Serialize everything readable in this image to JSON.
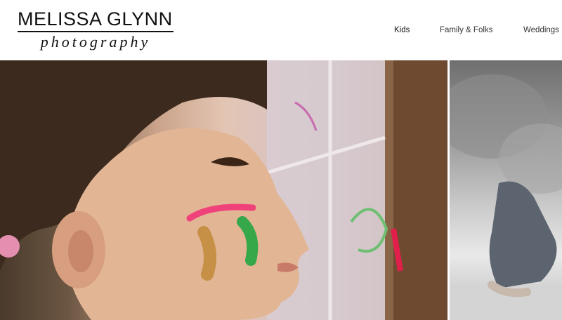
{
  "brand": {
    "name": "MELISSA GLYNN",
    "subtitle": "photography"
  },
  "nav": {
    "items": [
      {
        "label": "Kids",
        "active": true
      },
      {
        "label": "Family & Folks",
        "active": false
      },
      {
        "label": "Weddings",
        "active": false
      }
    ]
  },
  "colors": {
    "header_bg": "#ffffff",
    "text": "#111111"
  },
  "gallery": {
    "images": [
      {
        "name": "child-with-face-paint-at-window-photo"
      },
      {
        "name": "black-and-white-child-sitting-photo"
      }
    ]
  }
}
